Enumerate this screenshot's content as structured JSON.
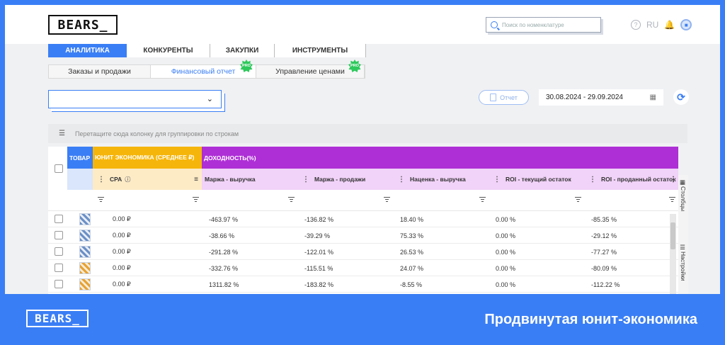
{
  "app": {
    "logo": "BEARS_",
    "footer_logo": "BEARS_",
    "footer_title": "Продвинутая юнит-экономика"
  },
  "header": {
    "search_placeholder": "Поиск по номенклатуре",
    "lang": "RU",
    "help": "?"
  },
  "tabs": [
    {
      "label": "АНАЛИТИКА",
      "active": true
    },
    {
      "label": "КОНКУРЕНТЫ",
      "active": false
    },
    {
      "label": "ЗАКУПКИ",
      "active": false
    },
    {
      "label": "ИНСТРУМЕНТЫ",
      "active": false
    }
  ],
  "subtabs": [
    {
      "label": "Заказы и продажи",
      "active": false,
      "pro": ""
    },
    {
      "label": "Финансовый отчет",
      "active": true,
      "pro": "PRO"
    },
    {
      "label": "Управление ценами",
      "active": false,
      "pro": "PRO"
    }
  ],
  "toolbar": {
    "report_label": "Отчет",
    "date_range": "30.08.2024 - 29.09.2024"
  },
  "groupbar": {
    "text": "Перетащите сюда колонку для группировки по строкам"
  },
  "table": {
    "groups": [
      {
        "label": "ТОВАР",
        "color": "#3a7ef5"
      },
      {
        "label": "ЮНИТ ЭКОНОМИКА (СРЕДНЕЕ ₽)",
        "color": "#f6b50a"
      },
      {
        "label": "ДОХОДНОСТЬ(%)",
        "color": "#ae2fd6"
      }
    ],
    "columns": [
      "CPA",
      "Маржа - выручка",
      "Маржа - продажи",
      "Наценка - выручка",
      "ROI - текущий остаток",
      "ROI - проданный остаток"
    ],
    "rows": [
      [
        "0.00 ₽",
        "-463.97 %",
        "-136.82 %",
        "18.40 %",
        "0.00 %",
        "-85.35 %"
      ],
      [
        "0.00 ₽",
        "-38.66 %",
        "-39.29 %",
        "75.33 %",
        "0.00 %",
        "-29.12 %"
      ],
      [
        "0.00 ₽",
        "-291.28 %",
        "-122.01 %",
        "26.53 %",
        "0.00 %",
        "-77.27 %"
      ],
      [
        "0.00 ₽",
        "-332.76 %",
        "-115.51 %",
        "24.07 %",
        "0.00 %",
        "-80.09 %"
      ],
      [
        "0.00 ₽",
        "1311.82 %",
        "-183.82 %",
        "-8.55 %",
        "0.00 %",
        "-112.22 %"
      ]
    ]
  },
  "sidepanel": {
    "columns_label": "Столбцы",
    "settings_label": "Настройки"
  }
}
